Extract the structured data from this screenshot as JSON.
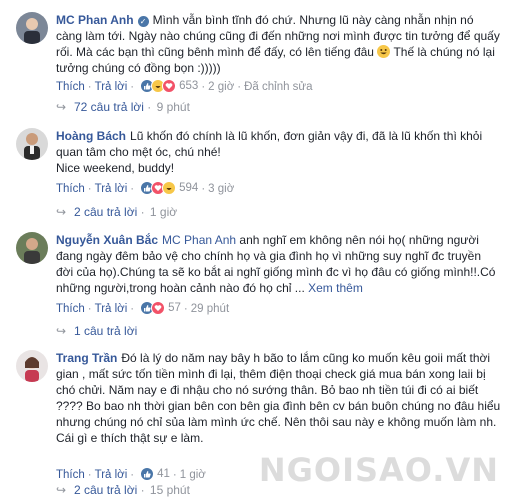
{
  "comments": [
    {
      "author": "MC Phan Anh",
      "verified": true,
      "text_before_emoji": "Mình vẫn bình tĩnh đó chứ. Nhưng lũ này càng nhẫn nhịn nó càng làm tới. Ngày nào chúng cũng đi đến những nơi mình được tin tưởng để quấy rối. Mà các bạn thì cũng bênh mình để đấy, có lên tiếng đâu",
      "text_after_emoji": "Thế là chúng nó lại tưởng chúng có đồng bọn :)))))",
      "emoji": "grin-emoji",
      "actions": {
        "like": "Thích",
        "reply": "Trả lời"
      },
      "reaction_count": "653",
      "time": "2 giờ",
      "edited": "Đã chỉnh sửa",
      "replies_label": "72 câu trả lời",
      "replies_ago": "9 phút"
    },
    {
      "author": "Hoàng Bách",
      "text_line1": "Lũ khốn đó chính là lũ khốn, đơn giản vậy đi, đã là lũ khốn thì khỏi quan tâm cho mệt óc, chú nhé!",
      "text_line2": "Nice weekend, buddy!",
      "actions": {
        "like": "Thích",
        "reply": "Trả lời"
      },
      "reaction_count": "594",
      "time": "3 giờ",
      "replies_label": "2 câu trả lời",
      "replies_ago": "1 giờ"
    },
    {
      "author": "Nguyễn Xuân Bắc",
      "mention": "MC Phan Anh",
      "text": "anh nghĩ em không nên nói họ( những người đang ngày đêm bảo vệ cho chính họ và gia đình họ vì những suy nghĩ đc truyền đời của họ).Chúng ta sẽ ko bắt ai nghĩ giống mình đc vì họ đâu có giống mình!!.Có những người,trong hoàn cảnh nào đó họ chỉ ...",
      "see_more": "Xem thêm",
      "actions": {
        "like": "Thích",
        "reply": "Trả lời"
      },
      "reaction_count": "57",
      "time": "29 phút",
      "replies_label": "1 câu trả lời"
    },
    {
      "author": "Trang Trần",
      "text": "Đó là lý do năm nay bây h bão to lắm cũng ko muốn kêu goii mất thời gian , mất sức tốn tiền mình đi lại, thêm điện thoại check giá mua bán xong laii bị chó chửi. Năm nay e đi nhậu cho nó sướng thân. Bỏ bao nh tiền túi đi có ai biết ???? Bo bao nh thời gian bên con bên gia đình bên cv bán buôn chúng no đâu hiểu nhưng chúng nó chỉ sủa làm mình ức chế. Nên thôi sau này e không muốn làm nh. Cái gì e thích thật sự e làm.",
      "actions": {
        "like": "Thích",
        "reply": "Trả lời"
      },
      "reaction_count": "41",
      "time": "1 giờ",
      "replies_label": "2 câu trả lời",
      "replies_ago": "15 phút"
    }
  ],
  "watermark": "NGOISAO.VN",
  "colors": {
    "link": "#365899",
    "meta": "#90949c",
    "text": "#1d2129",
    "like": "#4a76a8"
  }
}
